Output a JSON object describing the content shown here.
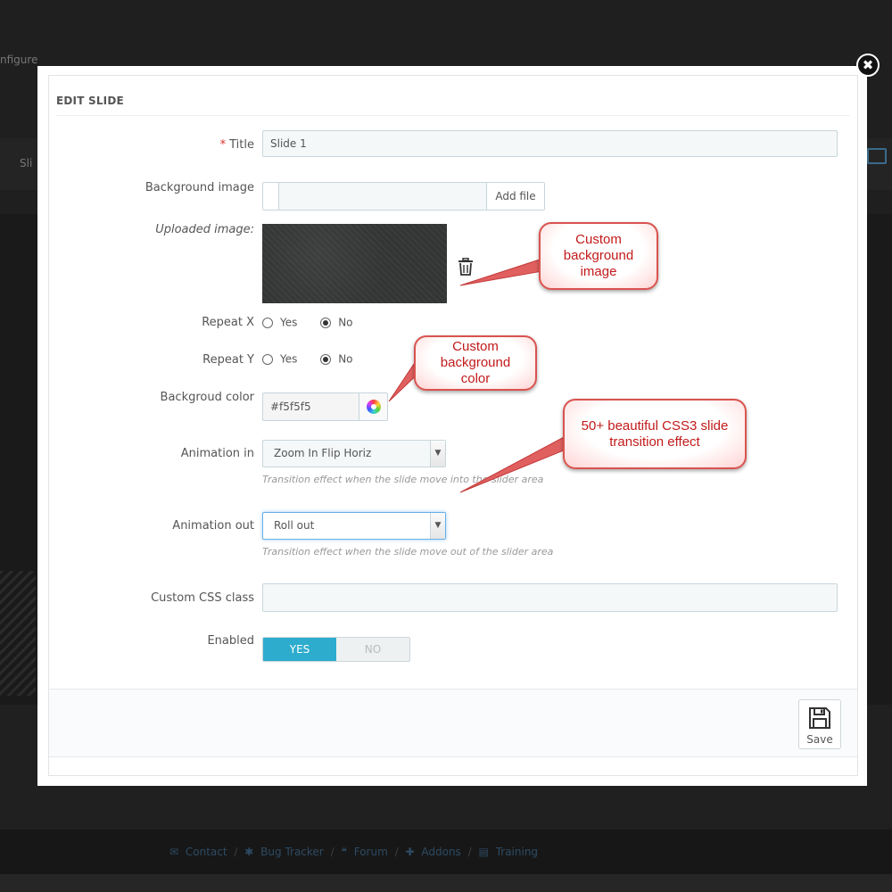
{
  "background": {
    "configure_text": "nfigure",
    "band_label": "Sli",
    "footer_links": [
      "Contact",
      "Bug Tracker",
      "Forum",
      "Addons",
      "Training"
    ]
  },
  "modal": {
    "heading": "EDIT SLIDE",
    "close_symbol": "✖",
    "required_mark": "*",
    "fields": {
      "title_label": "Title",
      "title_value": "Slide 1",
      "bg_image_label": "Background image",
      "bg_image_button": "Add file",
      "uploaded_label": "Uploaded image:",
      "repeat_x_label": "Repeat X",
      "repeat_y_label": "Repeat Y",
      "yes": "Yes",
      "no": "No",
      "repeat_x_selected": "No",
      "repeat_y_selected": "No",
      "bg_color_label": "Backgroud color",
      "bg_color_value": "#f5f5f5",
      "anim_in_label": "Animation in",
      "anim_in_value": "Zoom In Flip Horiz",
      "anim_in_help": "Transition effect when the slide move into the slider area",
      "anim_out_label": "Animation out",
      "anim_out_value": "Roll out",
      "anim_out_help": "Transition effect when the slide move out of the slider area",
      "css_class_label": "Custom CSS class",
      "css_class_value": "",
      "enabled_label": "Enabled",
      "enabled_yes": "YES",
      "enabled_no": "NO",
      "enabled_value": true
    },
    "save_label": "Save"
  },
  "callouts": {
    "bg_image": "Custom background image",
    "bg_color": "Custom background color",
    "transitions": "50+ beautiful CSS3 slide transition effect"
  },
  "colors": {
    "accent": "#2eacce",
    "required": "#e0322a",
    "callout_text": "#c21a1a",
    "callout_border": "#d9534f"
  },
  "icons": {
    "close": "close-icon",
    "trash": "trash-icon",
    "color_picker": "color-wheel-icon",
    "save": "floppy-disk-icon",
    "select_caret": "chevron-down-icon"
  }
}
